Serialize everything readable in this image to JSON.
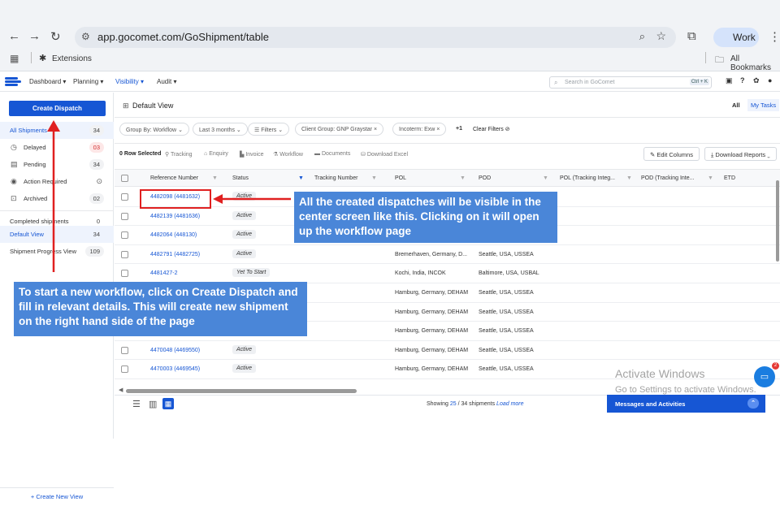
{
  "browser": {
    "url": "app.gocomet.com/GoShipment/table",
    "profile": "Work",
    "extensions_label": "Extensions",
    "all_bookmarks_label": "All Bookmarks"
  },
  "app_header": {
    "menus": [
      "Dashboard",
      "Planning",
      "Visibility",
      "Audit"
    ],
    "search_placeholder": "Search in GoComet",
    "search_shortcut": "Ctrl + K"
  },
  "sidebar": {
    "create_dispatch": "Create Dispatch",
    "items": [
      {
        "label": "All Shipments",
        "count": "34",
        "icon": ""
      },
      {
        "label": "Delayed",
        "count": "03",
        "icon": "clock-icon"
      },
      {
        "label": "Pending",
        "count": "34",
        "icon": "calendar-icon"
      },
      {
        "label": "Action Required",
        "count": "",
        "icon": "bell-icon"
      },
      {
        "label": "Archived",
        "count": "02",
        "icon": "archive-icon"
      }
    ],
    "views": [
      {
        "label": "Completed shipments",
        "count": "0"
      },
      {
        "label": "Default View",
        "count": "34"
      },
      {
        "label": "Shipment Progress View",
        "count": "109"
      }
    ],
    "create_new_view": "+ Create New View"
  },
  "main": {
    "view_title": "Default View",
    "tabs": [
      "All",
      "My Tasks"
    ],
    "filters": {
      "group_by": "Group By: Workflow",
      "last_months": "Last 3 months",
      "filters": "Filters",
      "client_group": "Client Group: GNP Graystar",
      "incoterm": "Incoterm: Exw",
      "more": "+1",
      "clear": "Clear Filters"
    },
    "actions": {
      "row_selected": "0 Row Selected",
      "tracking": "Tracking",
      "enquiry": "Enquiry",
      "invoice": "Invoice",
      "workflow": "Workflow",
      "documents": "Documents",
      "download_excel": "Download Excel",
      "edit_columns": "Edit Columns",
      "download_reports": "Download Reports"
    },
    "columns": [
      "Reference Number",
      "Status",
      "Tracking Number",
      "POL",
      "POD",
      "POL (Tracking Integ...",
      "POD (Tracking Inte...",
      "ETD"
    ],
    "rows": [
      {
        "ref": "4482098 (4481632)",
        "status": "Active",
        "pol": "",
        "pod": ""
      },
      {
        "ref": "4482139 (4481636)",
        "status": "Active",
        "pol": "",
        "pod": ""
      },
      {
        "ref": "4482064 (448130)",
        "status": "Active",
        "pol": "",
        "pod": ""
      },
      {
        "ref": "4482791 (4482725)",
        "status": "Active",
        "pol": "Bremerhaven, Germany, D...",
        "pod": "Seattle, USA, USSEA"
      },
      {
        "ref": "4481427-2",
        "status": "Yet To Start",
        "pol": "Kochi, India, INCOK",
        "pod": "Baltimore, USA, USBAL"
      },
      {
        "ref": "",
        "status": "",
        "pol": "Hamburg, Germany, DEHAM",
        "pod": "Seattle, USA, USSEA"
      },
      {
        "ref": "",
        "status": "",
        "pol": "Hamburg, Germany, DEHAM",
        "pod": "Seattle, USA, USSEA"
      },
      {
        "ref": "",
        "status": "",
        "pol": "Hamburg, Germany, DEHAM",
        "pod": "Seattle, USA, USSEA"
      },
      {
        "ref": "4470048 (4469550)",
        "status": "Active",
        "pol": "Hamburg, Germany, DEHAM",
        "pod": "Seattle, USA, USSEA"
      },
      {
        "ref": "4470003 (4469545)",
        "status": "Active",
        "pol": "Hamburg, Germany, DEHAM",
        "pod": "Seattle, USA, USSEA"
      }
    ],
    "footer": {
      "showing_prefix": "Showing",
      "showing_range": "25",
      "showing_suffix": "/ 34 shipments",
      "load_more": "Load more"
    },
    "messages": "Messages and Activities"
  },
  "callouts": {
    "dispatches": "All the created dispatches will be visible in the center screen like this. Clicking on it will open up the workflow page",
    "create": "To start a new workflow, click on Create Dispatch and fill in relevant details. This will create new shipment on the right hand side of the page"
  },
  "windows": {
    "activate_title": "Activate Windows",
    "activate_sub": "Go to Settings to activate Windows."
  },
  "colors": {
    "brand": "#1656d4",
    "callout": "#4a86d8",
    "arrow": "#e02020"
  }
}
